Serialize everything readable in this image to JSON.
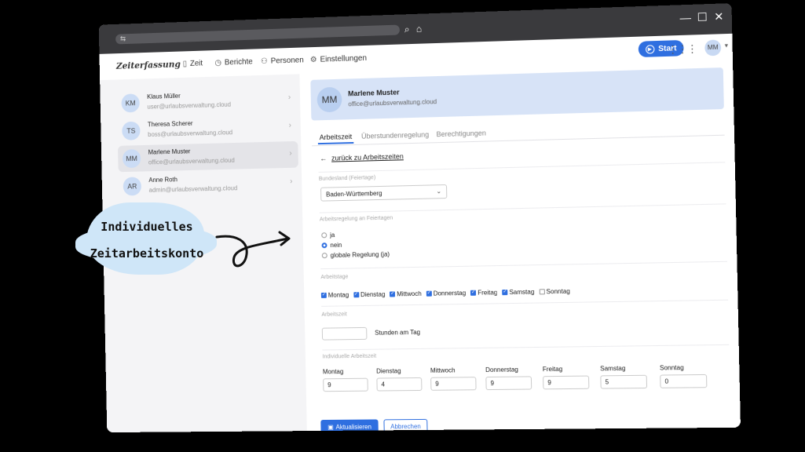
{
  "app": {
    "brand": "Zeiterfassung"
  },
  "nav": [
    {
      "label": "Zeit",
      "icon": "bookmark-icon"
    },
    {
      "label": "Berichte",
      "icon": "clock-icon"
    },
    {
      "label": "Personen",
      "icon": "people-icon"
    },
    {
      "label": "Einstellungen",
      "icon": "gear-icon"
    }
  ],
  "toolbar": {
    "start_label": "Start",
    "user_initials": "MM"
  },
  "people": [
    {
      "initials": "KM",
      "name": "Klaus Müller",
      "email": "user@urlaubsverwaltung.cloud"
    },
    {
      "initials": "TS",
      "name": "Theresa Scherer",
      "email": "boss@urlaubsverwaltung.cloud"
    },
    {
      "initials": "MM",
      "name": "Marlene Muster",
      "email": "office@urlaubsverwaltung.cloud"
    },
    {
      "initials": "AR",
      "name": "Anne Roth",
      "email": "admin@urlaubsverwaltung.cloud"
    }
  ],
  "selected": {
    "initials": "MM",
    "name": "Marlene Muster",
    "email": "office@urlaubsverwaltung.cloud"
  },
  "tabs": [
    "Arbeitszeit",
    "Überstundenregelung",
    "Berechtigungen"
  ],
  "back_link": "zurück zu Arbeitszeiten",
  "form": {
    "state_label": "Bundesland (Feiertage)",
    "state_value": "Baden-Württemberg",
    "holiday_rule_label": "Arbeitsregelung an Feiertagen",
    "holiday_options": [
      "ja",
      "nein",
      "globale Regelung (ja)"
    ],
    "holiday_selected": "nein",
    "workdays_label": "Arbeitstage",
    "workdays": [
      {
        "label": "Montag",
        "checked": true
      },
      {
        "label": "Dienstag",
        "checked": true
      },
      {
        "label": "Mittwoch",
        "checked": true
      },
      {
        "label": "Donnerstag",
        "checked": true
      },
      {
        "label": "Freitag",
        "checked": true
      },
      {
        "label": "Samstag",
        "checked": true
      },
      {
        "label": "Sonntag",
        "checked": false
      }
    ],
    "worktime_label": "Arbeitszeit",
    "hours_suffix": "Stunden am Tag",
    "individual_label": "Individuelle Arbeitszeit",
    "individual": [
      {
        "day": "Montag",
        "value": "9"
      },
      {
        "day": "Dienstag",
        "value": "4"
      },
      {
        "day": "Mittwoch",
        "value": "9"
      },
      {
        "day": "Donnerstag",
        "value": "9"
      },
      {
        "day": "Freitag",
        "value": "9"
      },
      {
        "day": "Samstag",
        "value": "5"
      },
      {
        "day": "Sonntag",
        "value": "0"
      }
    ],
    "submit_label": "Aktualisieren",
    "cancel_label": "Abbrechen"
  },
  "callout": {
    "line1": "Individuelles",
    "line2": "Zeitarbeitskonto"
  },
  "colors": {
    "accent": "#2f6fe0",
    "header_bg": "#d7e3f7",
    "callout_bg": "#cfe6f8"
  }
}
